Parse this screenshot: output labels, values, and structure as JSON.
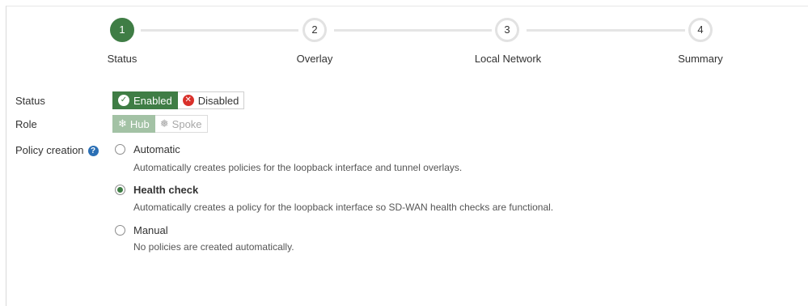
{
  "stepper": {
    "steps": [
      {
        "number": "1",
        "label": "Status",
        "active": true
      },
      {
        "number": "2",
        "label": "Overlay",
        "active": false
      },
      {
        "number": "3",
        "label": "Local Network",
        "active": false
      },
      {
        "number": "4",
        "label": "Summary",
        "active": false
      }
    ]
  },
  "form": {
    "status": {
      "label": "Status",
      "options": [
        {
          "label": "Enabled",
          "icon": "check-circle-icon",
          "selected": true
        },
        {
          "label": "Disabled",
          "icon": "x-circle-icon",
          "selected": false
        }
      ]
    },
    "role": {
      "label": "Role",
      "disabled": true,
      "options": [
        {
          "label": "Hub",
          "icon": "hub-icon",
          "selected": true
        },
        {
          "label": "Spoke",
          "icon": "spoke-icon",
          "selected": false
        }
      ]
    },
    "policy_creation": {
      "label": "Policy creation",
      "help_icon": "question-circle-icon",
      "options": [
        {
          "label": "Automatic",
          "description": "Automatically creates policies for the loopback interface and tunnel overlays.",
          "selected": false
        },
        {
          "label": "Health check",
          "description": "Automatically creates a policy for the loopback interface so SD-WAN health checks are functional.",
          "selected": true
        },
        {
          "label": "Manual",
          "description": "No policies are created automatically.",
          "selected": false
        }
      ]
    }
  },
  "colors": {
    "accent": "#3f7d45",
    "danger": "#d9312b",
    "help": "#2a6fb5"
  }
}
